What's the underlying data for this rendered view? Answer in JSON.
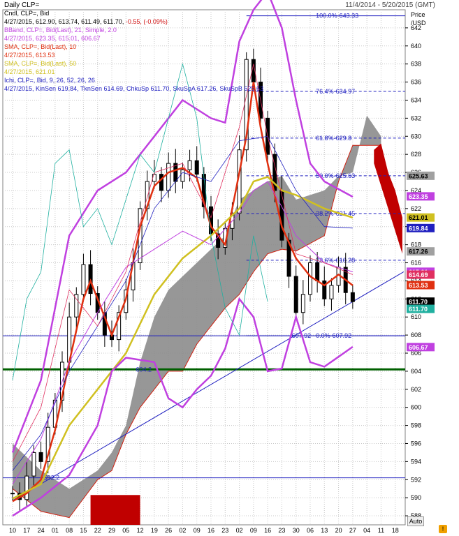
{
  "header": {
    "title": "Daily CLP=",
    "range": "11/4/2014 - 5/20/2015 (GMT)"
  },
  "axis": {
    "price_label": "Price",
    "unit_label": "/USD",
    "auto_label": "Auto"
  },
  "legend": [
    {
      "text": "Cndl, CLP=, Bid",
      "color": "#000000"
    },
    {
      "text": "4/27/2015, 612.90, 613.74, 611.49, 611.70, -0.55, (-0.09%)",
      "color": "#000000",
      "neg": "-0.55, (-0.09%)"
    },
    {
      "text": "BBand, CLP=, Bid(Last),  21, Simple, 2.0",
      "color": "#c040e0"
    },
    {
      "text": "4/27/2015, 623.35, 615.01, 606.67",
      "color": "#c040e0"
    },
    {
      "text": "SMA, CLP=, Bid(Last),  10",
      "color": "#e03010"
    },
    {
      "text": "4/27/2015, 613.53",
      "color": "#e03010"
    },
    {
      "text": "SMA, CLP=, Bid(Last),  50",
      "color": "#d0c020"
    },
    {
      "text": "4/27/2015, 621.01",
      "color": "#d0c020"
    },
    {
      "text": "Ichi, CLP=, Bid,  9, 26, 52, 26, 26",
      "color": "#2020c0"
    },
    {
      "text": "4/27/2015, KinSen 619.84, TknSen 614.69, ChkuSp 611.70, SkuSpA 617.26, SkuSpB 625.63",
      "color": "#2020c0"
    }
  ],
  "chart_data": {
    "type": "candlestick",
    "ylim": [
      587,
      644
    ],
    "y_ticks": [
      588,
      590,
      592,
      594,
      596,
      598,
      600,
      602,
      604,
      606,
      608,
      610,
      612,
      614,
      616,
      618,
      620,
      622,
      624,
      626,
      628,
      630,
      632,
      634,
      636,
      638,
      640,
      642
    ],
    "x_ticks": [
      "10",
      "17",
      "24",
      "01",
      "08",
      "15",
      "22",
      "29",
      "05",
      "12",
      "19",
      "26",
      "02",
      "09",
      "16",
      "23",
      "02",
      "09",
      "16",
      "23",
      "30",
      "06",
      "13",
      "20",
      "27",
      "04",
      "11",
      "18"
    ],
    "fibonacci": [
      {
        "label": "100.0%",
        "value": 643.33,
        "text": "643.33"
      },
      {
        "label": "76.4%",
        "value": 634.97,
        "text": "634.97"
      },
      {
        "label": "61.8%",
        "value": 629.8,
        "text": "629.8"
      },
      {
        "label": "50.0%",
        "value": 625.63,
        "text": "625.63"
      },
      {
        "label": "38.2%",
        "value": 621.45,
        "text": "621.45"
      },
      {
        "label": "23.6%",
        "value": 616.28,
        "text": "616.28"
      },
      {
        "label": "0.0%",
        "value": 607.92,
        "text": "607.92"
      }
    ],
    "annotations": [
      {
        "text": "607.92",
        "value": 607.92
      },
      {
        "text": "604.2",
        "value": 604.2
      },
      {
        "text": "592.2",
        "value": 592.2
      }
    ],
    "horizontal_lines": [
      {
        "value": 607.92,
        "color": "#2020c0",
        "width": 1
      },
      {
        "value": 604.2,
        "color": "#006000",
        "width": 3
      },
      {
        "value": 592.2,
        "color": "#2020c0",
        "width": 1
      }
    ],
    "trendline": {
      "from": [
        0,
        589.7
      ],
      "to": [
        27.6,
        615.0
      ]
    },
    "price_labels": [
      {
        "text": "625.63",
        "value": 625.63,
        "bg": "#a0a0a0",
        "fg": "#000000"
      },
      {
        "text": "623.35",
        "value": 623.35,
        "bg": "#c040e0",
        "fg": "#ffffff"
      },
      {
        "text": "621.01",
        "value": 621.01,
        "bg": "#d0c020",
        "fg": "#000000"
      },
      {
        "text": "619.84",
        "value": 619.84,
        "bg": "#2020c0",
        "fg": "#ffffff"
      },
      {
        "text": "617.26",
        "value": 617.26,
        "bg": "#a0a0a0",
        "fg": "#000000"
      },
      {
        "text": "615.01",
        "value": 615.01,
        "bg": "#c040e0",
        "fg": "#ffffff"
      },
      {
        "text": "614.69",
        "value": 614.69,
        "bg": "#e03060",
        "fg": "#ffffff"
      },
      {
        "text": "613.53",
        "value": 613.53,
        "bg": "#e03010",
        "fg": "#ffffff"
      },
      {
        "text": "611.70",
        "value": 611.7,
        "bg": "#000000",
        "fg": "#ffffff"
      },
      {
        "text": "611.70",
        "value": 610.9,
        "bg": "#20b0a0",
        "fg": "#ffffff"
      },
      {
        "text": "606.67",
        "value": 606.67,
        "bg": "#c040e0",
        "fg": "#ffffff"
      }
    ],
    "series": [
      {
        "name": "close",
        "points": [
          [
            0,
            590.5
          ],
          [
            0.5,
            589.8
          ],
          [
            1,
            592.4
          ],
          [
            1.5,
            595
          ],
          [
            2,
            594
          ],
          [
            2.5,
            597.8
          ],
          [
            3,
            600.8
          ],
          [
            3.5,
            605
          ],
          [
            4,
            610
          ],
          [
            4.5,
            612.5
          ],
          [
            5,
            615.8
          ],
          [
            5.5,
            612.6
          ],
          [
            6,
            610.5
          ],
          [
            6.5,
            608
          ],
          [
            7,
            607.5
          ],
          [
            7.5,
            610.5
          ],
          [
            8,
            613
          ],
          [
            8.5,
            616
          ],
          [
            9,
            622
          ],
          [
            9.5,
            625
          ],
          [
            10,
            625.8
          ],
          [
            10.5,
            624
          ],
          [
            11,
            627
          ],
          [
            11.5,
            625
          ],
          [
            12,
            626.3
          ],
          [
            12.5,
            627.3
          ],
          [
            13,
            625.8
          ],
          [
            13.5,
            622.2
          ],
          [
            14,
            619.2
          ],
          [
            14.5,
            617.7
          ],
          [
            15,
            619.8
          ],
          [
            15.5,
            621.5
          ],
          [
            16,
            628.5
          ],
          [
            16.5,
            638.5
          ],
          [
            17,
            636
          ],
          [
            17.5,
            632
          ],
          [
            18,
            628
          ],
          [
            18.5,
            624
          ],
          [
            19,
            618.5
          ],
          [
            19.5,
            614.5
          ],
          [
            20,
            610.5
          ],
          [
            20.5,
            612.5
          ],
          [
            21,
            616
          ],
          [
            21.5,
            614
          ],
          [
            22,
            612
          ],
          [
            22.5,
            613.5
          ],
          [
            23,
            615.5
          ],
          [
            23.5,
            612.7
          ],
          [
            24,
            611.7
          ]
        ]
      },
      {
        "name": "sma10",
        "points": [
          [
            0,
            589.6
          ],
          [
            1,
            590.5
          ],
          [
            2,
            592
          ],
          [
            3,
            597.5
          ],
          [
            4,
            605
          ],
          [
            5,
            612
          ],
          [
            5.5,
            614
          ],
          [
            6,
            612
          ],
          [
            7,
            608
          ],
          [
            8,
            612
          ],
          [
            9,
            620
          ],
          [
            10,
            624.5
          ],
          [
            11,
            626
          ],
          [
            12,
            626.5
          ],
          [
            13,
            625.4
          ],
          [
            14,
            620
          ],
          [
            15,
            618
          ],
          [
            16,
            626
          ],
          [
            16.5,
            630
          ],
          [
            17,
            636
          ],
          [
            17.5,
            631
          ],
          [
            18,
            627
          ],
          [
            19,
            620
          ],
          [
            20,
            616.5
          ],
          [
            21,
            614.5
          ],
          [
            22,
            613.5
          ],
          [
            23,
            614.7
          ],
          [
            24,
            613.5
          ]
        ]
      },
      {
        "name": "sma50",
        "points": [
          [
            0,
            589.9
          ],
          [
            2,
            591.5
          ],
          [
            4,
            598
          ],
          [
            6,
            602
          ],
          [
            8,
            606
          ],
          [
            10,
            612.5
          ],
          [
            12,
            616.5
          ],
          [
            14,
            619
          ],
          [
            16,
            622
          ],
          [
            17,
            625
          ],
          [
            18,
            625.5
          ],
          [
            19,
            624
          ],
          [
            20,
            623.5
          ],
          [
            22,
            622
          ],
          [
            24,
            621
          ]
        ]
      },
      {
        "name": "bb_upper",
        "points": [
          [
            0,
            595
          ],
          [
            2,
            603
          ],
          [
            4,
            619
          ],
          [
            6,
            624
          ],
          [
            8,
            626
          ],
          [
            10,
            630
          ],
          [
            12,
            634
          ],
          [
            14,
            632
          ],
          [
            15,
            631.5
          ],
          [
            16,
            640.5
          ],
          [
            17,
            644
          ],
          [
            18,
            646
          ],
          [
            19,
            642
          ],
          [
            20,
            634
          ],
          [
            21,
            627
          ],
          [
            22,
            625
          ],
          [
            24,
            623.3
          ]
        ]
      },
      {
        "name": "bb_lower",
        "points": [
          [
            0,
            588
          ],
          [
            2,
            590
          ],
          [
            4,
            592.5
          ],
          [
            6,
            598
          ],
          [
            7,
            604
          ],
          [
            8,
            605.5
          ],
          [
            10,
            605
          ],
          [
            11,
            601
          ],
          [
            12,
            600
          ],
          [
            13,
            602
          ],
          [
            14,
            603.5
          ],
          [
            15,
            606.5
          ],
          [
            16,
            612
          ],
          [
            17,
            610
          ],
          [
            18,
            604
          ],
          [
            19,
            604.3
          ],
          [
            20,
            610
          ],
          [
            21,
            605
          ],
          [
            22,
            604.5
          ],
          [
            23,
            605.6
          ],
          [
            24,
            606.7
          ]
        ]
      },
      {
        "name": "bb_mid",
        "points": [
          [
            0,
            591.5
          ],
          [
            2,
            596.5
          ],
          [
            4,
            605
          ],
          [
            6,
            610.5
          ],
          [
            8,
            615.5
          ],
          [
            10,
            617.5
          ],
          [
            12,
            619.5
          ],
          [
            14,
            618
          ],
          [
            16,
            621.5
          ],
          [
            17,
            624
          ],
          [
            18,
            625
          ],
          [
            19,
            622.2
          ],
          [
            20,
            619
          ],
          [
            22,
            616
          ],
          [
            24,
            615.0
          ]
        ]
      },
      {
        "name": "kijun",
        "points": [
          [
            0,
            593
          ],
          [
            2,
            597
          ],
          [
            4,
            604
          ],
          [
            6,
            609
          ],
          [
            8,
            614
          ],
          [
            10,
            622
          ],
          [
            12,
            626
          ],
          [
            14,
            625
          ],
          [
            16,
            629.5
          ],
          [
            18,
            630
          ],
          [
            20,
            624
          ],
          [
            22,
            620
          ],
          [
            24,
            619.84
          ]
        ]
      },
      {
        "name": "tenkan",
        "points": [
          [
            0,
            594
          ],
          [
            2,
            600
          ],
          [
            4,
            613
          ],
          [
            6,
            609
          ],
          [
            8,
            615
          ],
          [
            10,
            626
          ],
          [
            12,
            627
          ],
          [
            14,
            621
          ],
          [
            16,
            631
          ],
          [
            17,
            638
          ],
          [
            18,
            630
          ],
          [
            20,
            617
          ],
          [
            22,
            616
          ],
          [
            24,
            614.69
          ]
        ]
      },
      {
        "name": "chikou",
        "points": [
          [
            0,
            603
          ],
          [
            1,
            612
          ],
          [
            2,
            615
          ],
          [
            3,
            627
          ],
          [
            4,
            628.5
          ],
          [
            5,
            620
          ],
          [
            6,
            622
          ],
          [
            7,
            618
          ],
          [
            8,
            623
          ],
          [
            9,
            628
          ],
          [
            10,
            626
          ],
          [
            11,
            632
          ],
          [
            12,
            638
          ],
          [
            13,
            632
          ],
          [
            14,
            619
          ],
          [
            15,
            611
          ],
          [
            16,
            608
          ],
          [
            17,
            619
          ],
          [
            18,
            611.7
          ]
        ]
      }
    ],
    "cloud": {
      "upper": [
        [
          0,
          596
        ],
        [
          2,
          593
        ],
        [
          4,
          591
        ],
        [
          6,
          593
        ],
        [
          7,
          595
        ],
        [
          8,
          598
        ],
        [
          9,
          605
        ],
        [
          10,
          610
        ],
        [
          11,
          613
        ],
        [
          12,
          614.5
        ],
        [
          13,
          616
        ],
        [
          14,
          617.5
        ],
        [
          15,
          619
        ],
        [
          16,
          623
        ],
        [
          17,
          624
        ],
        [
          18,
          625
        ],
        [
          19,
          625.6
        ],
        [
          20,
          623
        ],
        [
          22,
          624
        ],
        [
          23,
          625.6
        ],
        [
          24,
          626
        ],
        [
          25,
          632.3
        ],
        [
          26,
          630
        ]
      ],
      "lower": [
        [
          0,
          591
        ],
        [
          2,
          588.5
        ],
        [
          4,
          587.8
        ],
        [
          6,
          592
        ],
        [
          7,
          593
        ],
        [
          8,
          597
        ],
        [
          9,
          600
        ],
        [
          10,
          602
        ],
        [
          11,
          604
        ],
        [
          12,
          604
        ],
        [
          13,
          607
        ],
        [
          14,
          609
        ],
        [
          15,
          611
        ],
        [
          16,
          612.5
        ],
        [
          17,
          615
        ],
        [
          18,
          617
        ],
        [
          19,
          617.5
        ],
        [
          20,
          617.3
        ],
        [
          22,
          619
        ],
        [
          23,
          625
        ],
        [
          24,
          629
        ],
        [
          25,
          629
        ],
        [
          26,
          629
        ]
      ],
      "red_bear": [
        [
          25.5,
          628.5
        ],
        [
          26,
          629.2
        ],
        [
          26.5,
          626
        ],
        [
          27,
          624
        ],
        [
          27.5,
          621
        ]
      ]
    }
  }
}
